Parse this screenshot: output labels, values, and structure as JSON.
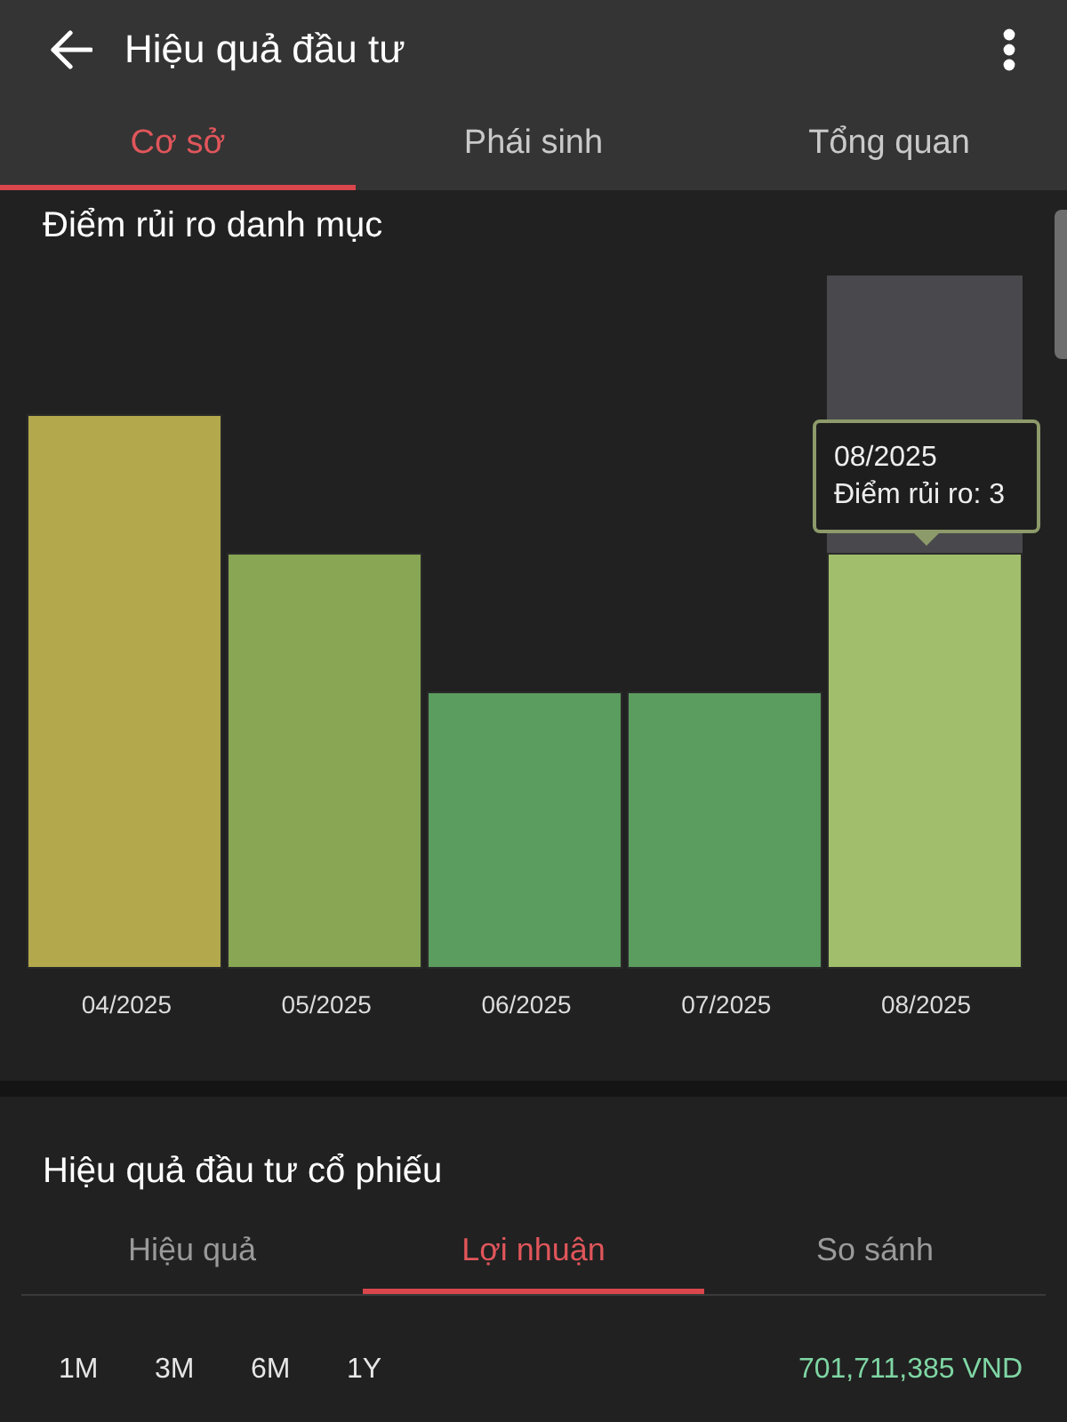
{
  "header": {
    "title": "Hiệu quả đầu tư"
  },
  "tabs": [
    {
      "label": "Cơ sở",
      "selected": true
    },
    {
      "label": "Phái sinh",
      "selected": false
    },
    {
      "label": "Tổng quan",
      "selected": false
    }
  ],
  "risk_chart": {
    "title": "Điểm rủi ro danh mục",
    "bars": [
      {
        "label": "04/2025",
        "color": "#b3a94c",
        "selected": false
      },
      {
        "label": "05/2025",
        "color": "#88a653",
        "selected": false
      },
      {
        "label": "06/2025",
        "color": "#5b9c5f",
        "selected": false
      },
      {
        "label": "07/2025",
        "color": "#5b9c5f",
        "selected": false
      },
      {
        "label": "08/2025",
        "color": "#a0be6c",
        "selected": true
      }
    ],
    "tooltip": {
      "date": "08/2025",
      "text": "Điểm rủi ro: 3"
    }
  },
  "stock_performance": {
    "title": "Hiệu quả đầu tư cổ phiếu",
    "tabs": [
      {
        "label": "Hiệu quả",
        "selected": false
      },
      {
        "label": "Lợi nhuận",
        "selected": true
      },
      {
        "label": "So sánh",
        "selected": false
      }
    ],
    "periods": [
      "1M",
      "3M",
      "6M",
      "1Y"
    ],
    "profit": "701,711,385 VND"
  }
}
